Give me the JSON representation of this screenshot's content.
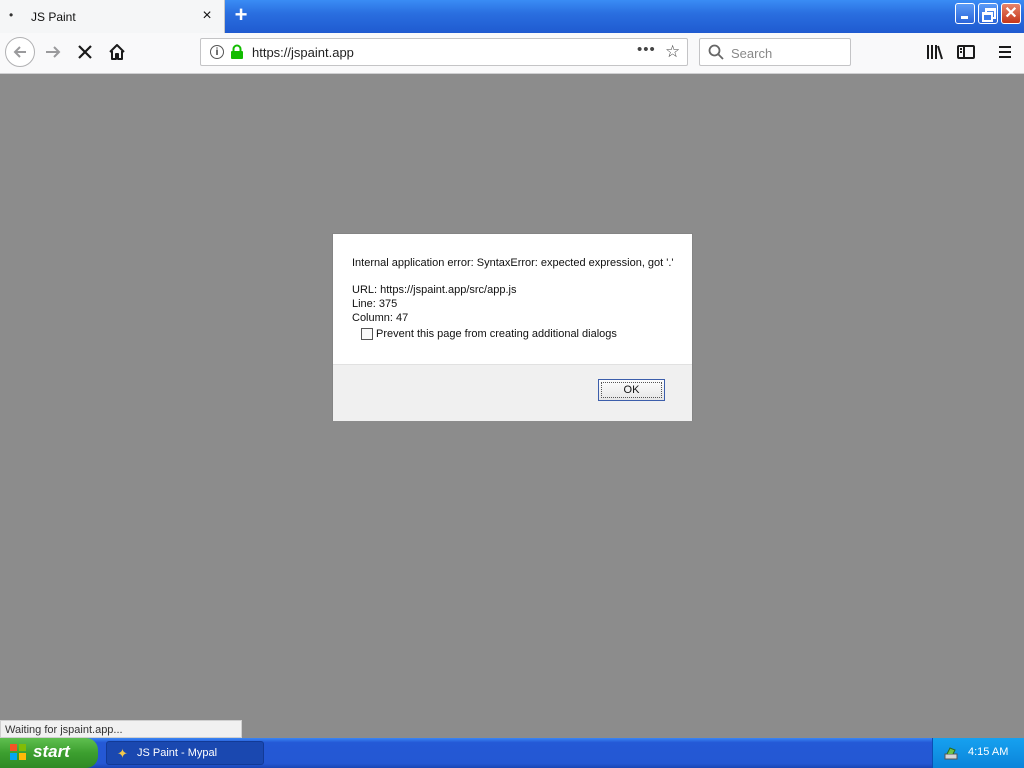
{
  "browser": {
    "tab_title": "JS Paint",
    "tab_dot": "•",
    "tab_close": "×",
    "new_tab": "+",
    "url": "https://jspaint.app",
    "url_menu": "•••",
    "bookmark_star": "☆",
    "search_placeholder": "Search"
  },
  "dialog": {
    "message": "Internal application error: SyntaxError: expected expression, got '.'",
    "url_line": "URL: https://jspaint.app/src/app.js",
    "line_line": "Line: 375",
    "column_line": "Column: 47",
    "checkbox_label": "Prevent this page from creating additional dialogs",
    "ok_label": "OK"
  },
  "status": {
    "text": "Waiting for jspaint.app..."
  },
  "taskbar": {
    "start_label": "start",
    "app_label": "JS Paint - Mypal",
    "clock": "4:15 AM"
  },
  "colors": {
    "page_background": "#8c8c8c",
    "secure_lock": "#12bc00",
    "taskbar_blue": "#2457d3",
    "start_green": "#3c9f2f"
  }
}
